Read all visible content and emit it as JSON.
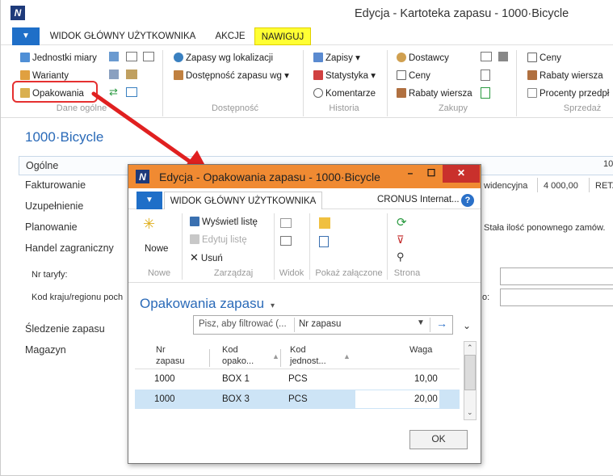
{
  "window": {
    "title": "Edycja - Kartoteka zapasu - 1000·Bicycle"
  },
  "tabs": [
    "WIDOK GŁÓWNY UŻYTKOWNIKA",
    "AKCJE",
    "NAWIGUJ"
  ],
  "ribbon": {
    "col1": [
      "Jednostki miary",
      "Warianty",
      "Opakowania"
    ],
    "col1_group": "Dane ogólne",
    "col2": [
      "Zapasy wg lokalizacji",
      "Dostępność zapasu wg ▾"
    ],
    "col2_group": "Dostępność",
    "col3": [
      "Zapisy ▾",
      "Statystyka ▾",
      "Komentarze"
    ],
    "col3_group": "Historia",
    "col4": [
      "Dostawcy",
      "Ceny",
      "Rabaty wiersza"
    ],
    "col4_group": "Zakupy",
    "col5": [
      "Ceny",
      "Rabaty wiersza",
      "Procenty przedpł"
    ],
    "col5_group": "Sprzedaż"
  },
  "page": {
    "title": "1000·Bicycle",
    "fasttabs": [
      "Ogólne",
      "Fakturowanie",
      "Uzupełnienie",
      "Planowanie",
      "Handel zagraniczny"
    ],
    "ogolne_value": "10",
    "fields": [
      "Nr taryfy:",
      "Kod kraju/regionu poch"
    ],
    "fasttabs_bottom": [
      "Śledzenie zapasu",
      "Magazyn"
    ],
    "right_texts": {
      "ewid": "widencyjna",
      "koszt": "4 000,00",
      "reta": "RETA",
      "stala": "Stała ilość ponownego zamów.",
      "colon": "o:"
    }
  },
  "dialog": {
    "title": "Edycja - Opakowania zapasu - 1000·Bicycle",
    "tab": "WIDOK GŁÓWNY UŻYTKOWNIKA",
    "company": "CRONUS Internat...",
    "ribbon": {
      "nowe": "Nowe",
      "wyswietl": "Wyświetl listę",
      "edytuj": "Edytuj listę",
      "usun": "Usuń",
      "groups": [
        "Nowe",
        "Zarządzaj",
        "Widok",
        "Pokaż załączone",
        "Strona"
      ]
    },
    "list_title": "Opakowania zapasu",
    "filter_placeholder": "Pisz, aby filtrować (...",
    "filter_field": "Nr zapasu",
    "columns": [
      {
        "line1": "Nr",
        "line2": "zapasu"
      },
      {
        "line1": "Kod",
        "line2": "opako..."
      },
      {
        "line1": "Kod",
        "line2": "jednost..."
      },
      {
        "line1": "Waga",
        "line2": ""
      }
    ],
    "rows": [
      {
        "nr": "1000",
        "kod": "BOX 1",
        "jm": "PCS",
        "waga": "10,00"
      },
      {
        "nr": "1000",
        "kod": "BOX 3",
        "jm": "PCS",
        "waga": "20,00"
      }
    ],
    "ok": "OK"
  }
}
